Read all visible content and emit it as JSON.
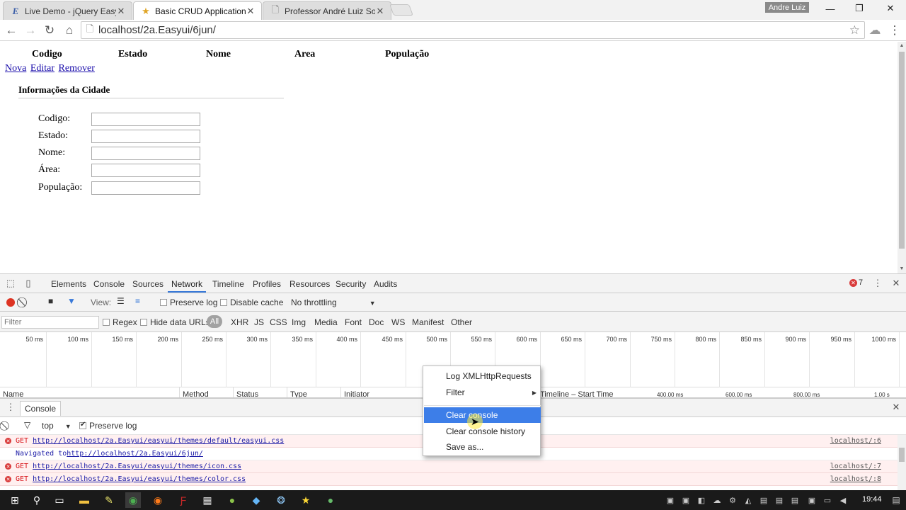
{
  "browser": {
    "tabs": [
      {
        "title": "Live Demo - jQuery EasyU",
        "icon": "easyui-e-icon",
        "active": false
      },
      {
        "title": "Basic CRUD Application - j",
        "icon": "star-favicon-icon",
        "active": true
      },
      {
        "title": "Professor André Luiz Sous",
        "icon": "page-icon",
        "active": false
      }
    ],
    "user": "Andre Luiz",
    "url": "localhost/2a.Easyui/6jun/"
  },
  "page": {
    "columns": [
      "Codigo",
      "Estado",
      "Nome",
      "Area",
      "População"
    ],
    "actions": [
      "Nova",
      "Editar",
      "Remover"
    ],
    "form_title": "Informações da Cidade",
    "fields": [
      {
        "label": "Codigo:",
        "value": ""
      },
      {
        "label": "Estado:",
        "value": ""
      },
      {
        "label": "Nome:",
        "value": ""
      },
      {
        "label": "Área:",
        "value": ""
      },
      {
        "label": "População:",
        "value": ""
      }
    ]
  },
  "devtools": {
    "tabs": [
      "Elements",
      "Console",
      "Sources",
      "Network",
      "Timeline",
      "Profiles",
      "Resources",
      "Security",
      "Audits"
    ],
    "active_tab": "Network",
    "error_count": "7",
    "toolbar": {
      "view_label": "View:",
      "preserve_log": "Preserve log",
      "disable_cache": "Disable cache",
      "throttling": "No throttling"
    },
    "filter_placeholder": "Filter",
    "regex_label": "Regex",
    "hide_data_urls": "Hide data URLs",
    "types": [
      "All",
      "XHR",
      "JS",
      "CSS",
      "Img",
      "Media",
      "Font",
      "Doc",
      "WS",
      "Manifest",
      "Other"
    ],
    "ticks": [
      "50 ms",
      "100 ms",
      "150 ms",
      "200 ms",
      "250 ms",
      "300 ms",
      "350 ms",
      "400 ms",
      "450 ms",
      "500 ms",
      "550 ms",
      "600 ms",
      "650 ms",
      "700 ms",
      "750 ms",
      "800 ms",
      "850 ms",
      "900 ms",
      "950 ms",
      "1000 ms"
    ],
    "table_headers": [
      "Name",
      "Method",
      "Status",
      "Type",
      "Initiator",
      "Timeline – Start Time",
      "400.00 ms",
      "600.00 ms",
      "800.00 ms",
      "1.00 s"
    ],
    "console": {
      "tab_label": "Console",
      "context": "top",
      "preserve_log": "Preserve log",
      "messages": [
        {
          "kind": "err",
          "method": "GET",
          "url": "http://localhost/2a.Easyui/easyui/themes/default/easyui.css",
          "source": "localhost/:6"
        },
        {
          "kind": "info",
          "text": "Navigated to ",
          "url": "http://localhost/2a.Easyui/6jun/",
          "source": ""
        },
        {
          "kind": "err",
          "method": "GET",
          "url": "http://localhost/2a.Easyui/easyui/themes/icon.css",
          "source": "localhost/:7"
        },
        {
          "kind": "err",
          "method": "GET",
          "url": "http://localhost/2a.Easyui/easyui/themes/color.css",
          "source": "localhost/:8"
        }
      ]
    }
  },
  "context_menu": {
    "items": [
      "Log XMLHttpRequests",
      "Filter",
      "Clear console",
      "Clear console history",
      "Save as..."
    ],
    "highlighted": "Clear console"
  },
  "taskbar": {
    "clock": "19:44"
  },
  "colors": {
    "accent": "#3879d9",
    "menu_highlight": "#3d7ee8",
    "error": "#d93a3a"
  }
}
